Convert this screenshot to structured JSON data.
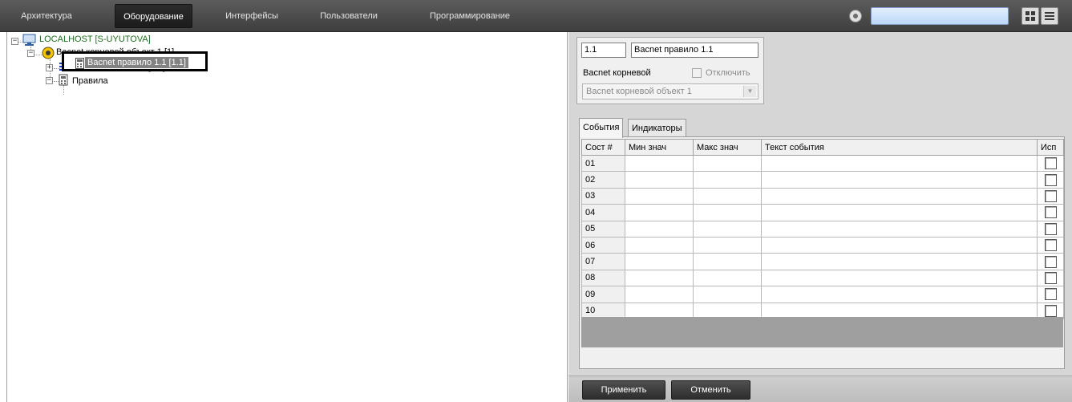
{
  "menu": {
    "tabs": [
      {
        "label": "Архитектура"
      },
      {
        "label": "Оборудование"
      },
      {
        "label": "Интерфейсы"
      },
      {
        "label": "Пользователи"
      },
      {
        "label": "Программирование"
      }
    ],
    "search_value": ""
  },
  "tree": {
    "root": "LOCALHOST [S-UYUTOVA]",
    "root_object": "Bacnet корневой объект 1 [1]",
    "panel": "Bacnet панель 1.1 [1.1]",
    "rules": "Правила",
    "rule": "Bacnet правило 1.1 [1.1]"
  },
  "props": {
    "id": "1.1",
    "name": "Bacnet правило 1.1",
    "parent_label": "Bacnet корневой",
    "disable_label": "Отключить",
    "parent_value": "Bacnet корневой объект 1"
  },
  "event_tabs": [
    "События",
    "Индикаторы"
  ],
  "grid": {
    "headers": [
      "Сост #",
      "Мин знач",
      "Макс знач",
      "Текст события",
      "Исп"
    ],
    "rows": [
      "01",
      "02",
      "03",
      "04",
      "05",
      "06",
      "07",
      "08",
      "09",
      "10"
    ]
  },
  "buttons": {
    "apply": "Применить",
    "cancel": "Отменить"
  },
  "colors": {
    "menu_bar": "#4a4a4a",
    "search_box": "#cfe2fb",
    "tree_root_text": "#1f6e1f",
    "selection": "#828282"
  }
}
